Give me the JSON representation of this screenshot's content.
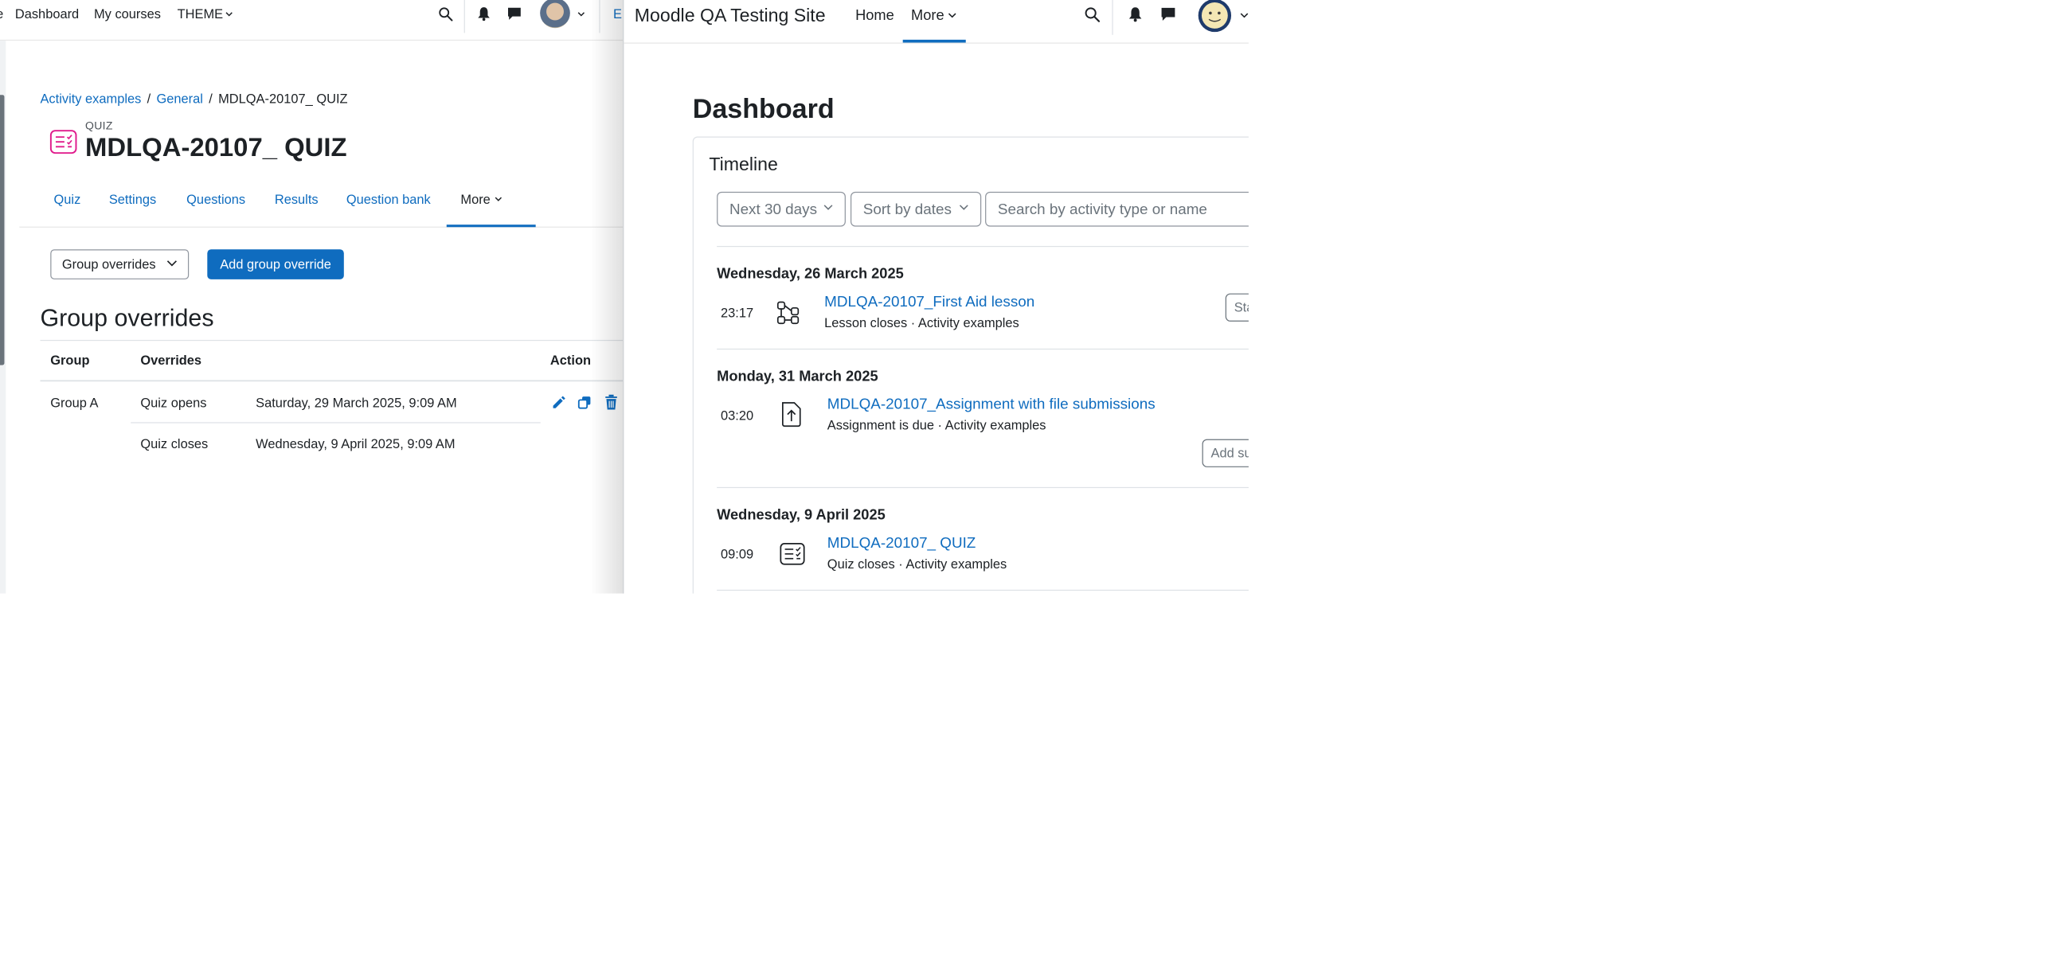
{
  "left_window": {
    "nav": {
      "items": [
        {
          "label": "e"
        },
        {
          "label": "Dashboard"
        },
        {
          "label": "My courses"
        },
        {
          "label": "THEME"
        }
      ],
      "edge_text": "E"
    },
    "breadcrumb": {
      "items": [
        "Activity examples",
        "General",
        "MDLQA-20107_ QUIZ"
      ],
      "separator": "/"
    },
    "activity": {
      "type_label": "QUIZ",
      "title": "MDLQA-20107_ QUIZ"
    },
    "tabs": [
      {
        "label": "Quiz"
      },
      {
        "label": "Settings"
      },
      {
        "label": "Questions"
      },
      {
        "label": "Results"
      },
      {
        "label": "Question bank"
      },
      {
        "label": "More",
        "active": true
      }
    ],
    "overrides_select": {
      "value": "Group overrides"
    },
    "add_button": {
      "label": "Add group override"
    },
    "section_heading": "Group overrides",
    "table": {
      "headers": [
        "Group",
        "Overrides",
        "Action"
      ],
      "rows": [
        {
          "group": "Group A",
          "overrides": [
            {
              "setting": "Quiz opens",
              "value": "Saturday, 29 March 2025, 9:09 AM"
            },
            {
              "setting": "Quiz closes",
              "value": "Wednesday, 9 April 2025, 9:09 AM"
            }
          ],
          "actions": [
            "edit-icon",
            "copy-icon",
            "trash-icon"
          ]
        }
      ]
    }
  },
  "right_window": {
    "site_name": "Moodle QA Testing Site",
    "nav": [
      {
        "label": "Home"
      },
      {
        "label": "More",
        "active": true
      }
    ],
    "page_heading": "Dashboard",
    "timeline": {
      "title": "Timeline",
      "filters": {
        "range": "Next 30 days",
        "sort": "Sort by dates",
        "search_placeholder": "Search by activity type or name"
      },
      "groups": [
        {
          "date": "Wednesday, 26 March 2025",
          "events": [
            {
              "time": "23:17",
              "icon": "lesson-icon",
              "name": "MDLQA-20107_First Aid lesson",
              "meta": "Lesson closes · Activity examples",
              "action": "Sta"
            }
          ]
        },
        {
          "date": "Monday, 31 March 2025",
          "events": [
            {
              "time": "03:20",
              "icon": "assignment-icon",
              "name": "MDLQA-20107_Assignment with file submissions",
              "meta": "Assignment is due · Activity examples",
              "action": "Add su"
            }
          ]
        },
        {
          "date": "Wednesday, 9 April 2025",
          "events": [
            {
              "time": "09:09",
              "icon": "quiz-icon",
              "name": "MDLQA-20107_ QUIZ",
              "meta": "Quiz closes · Activity examples"
            }
          ]
        }
      ]
    }
  },
  "colors": {
    "link": "#0f6cbf",
    "quiz_accent": "#e01b8c",
    "text": "#1d2125",
    "border": "#dee2e6"
  }
}
